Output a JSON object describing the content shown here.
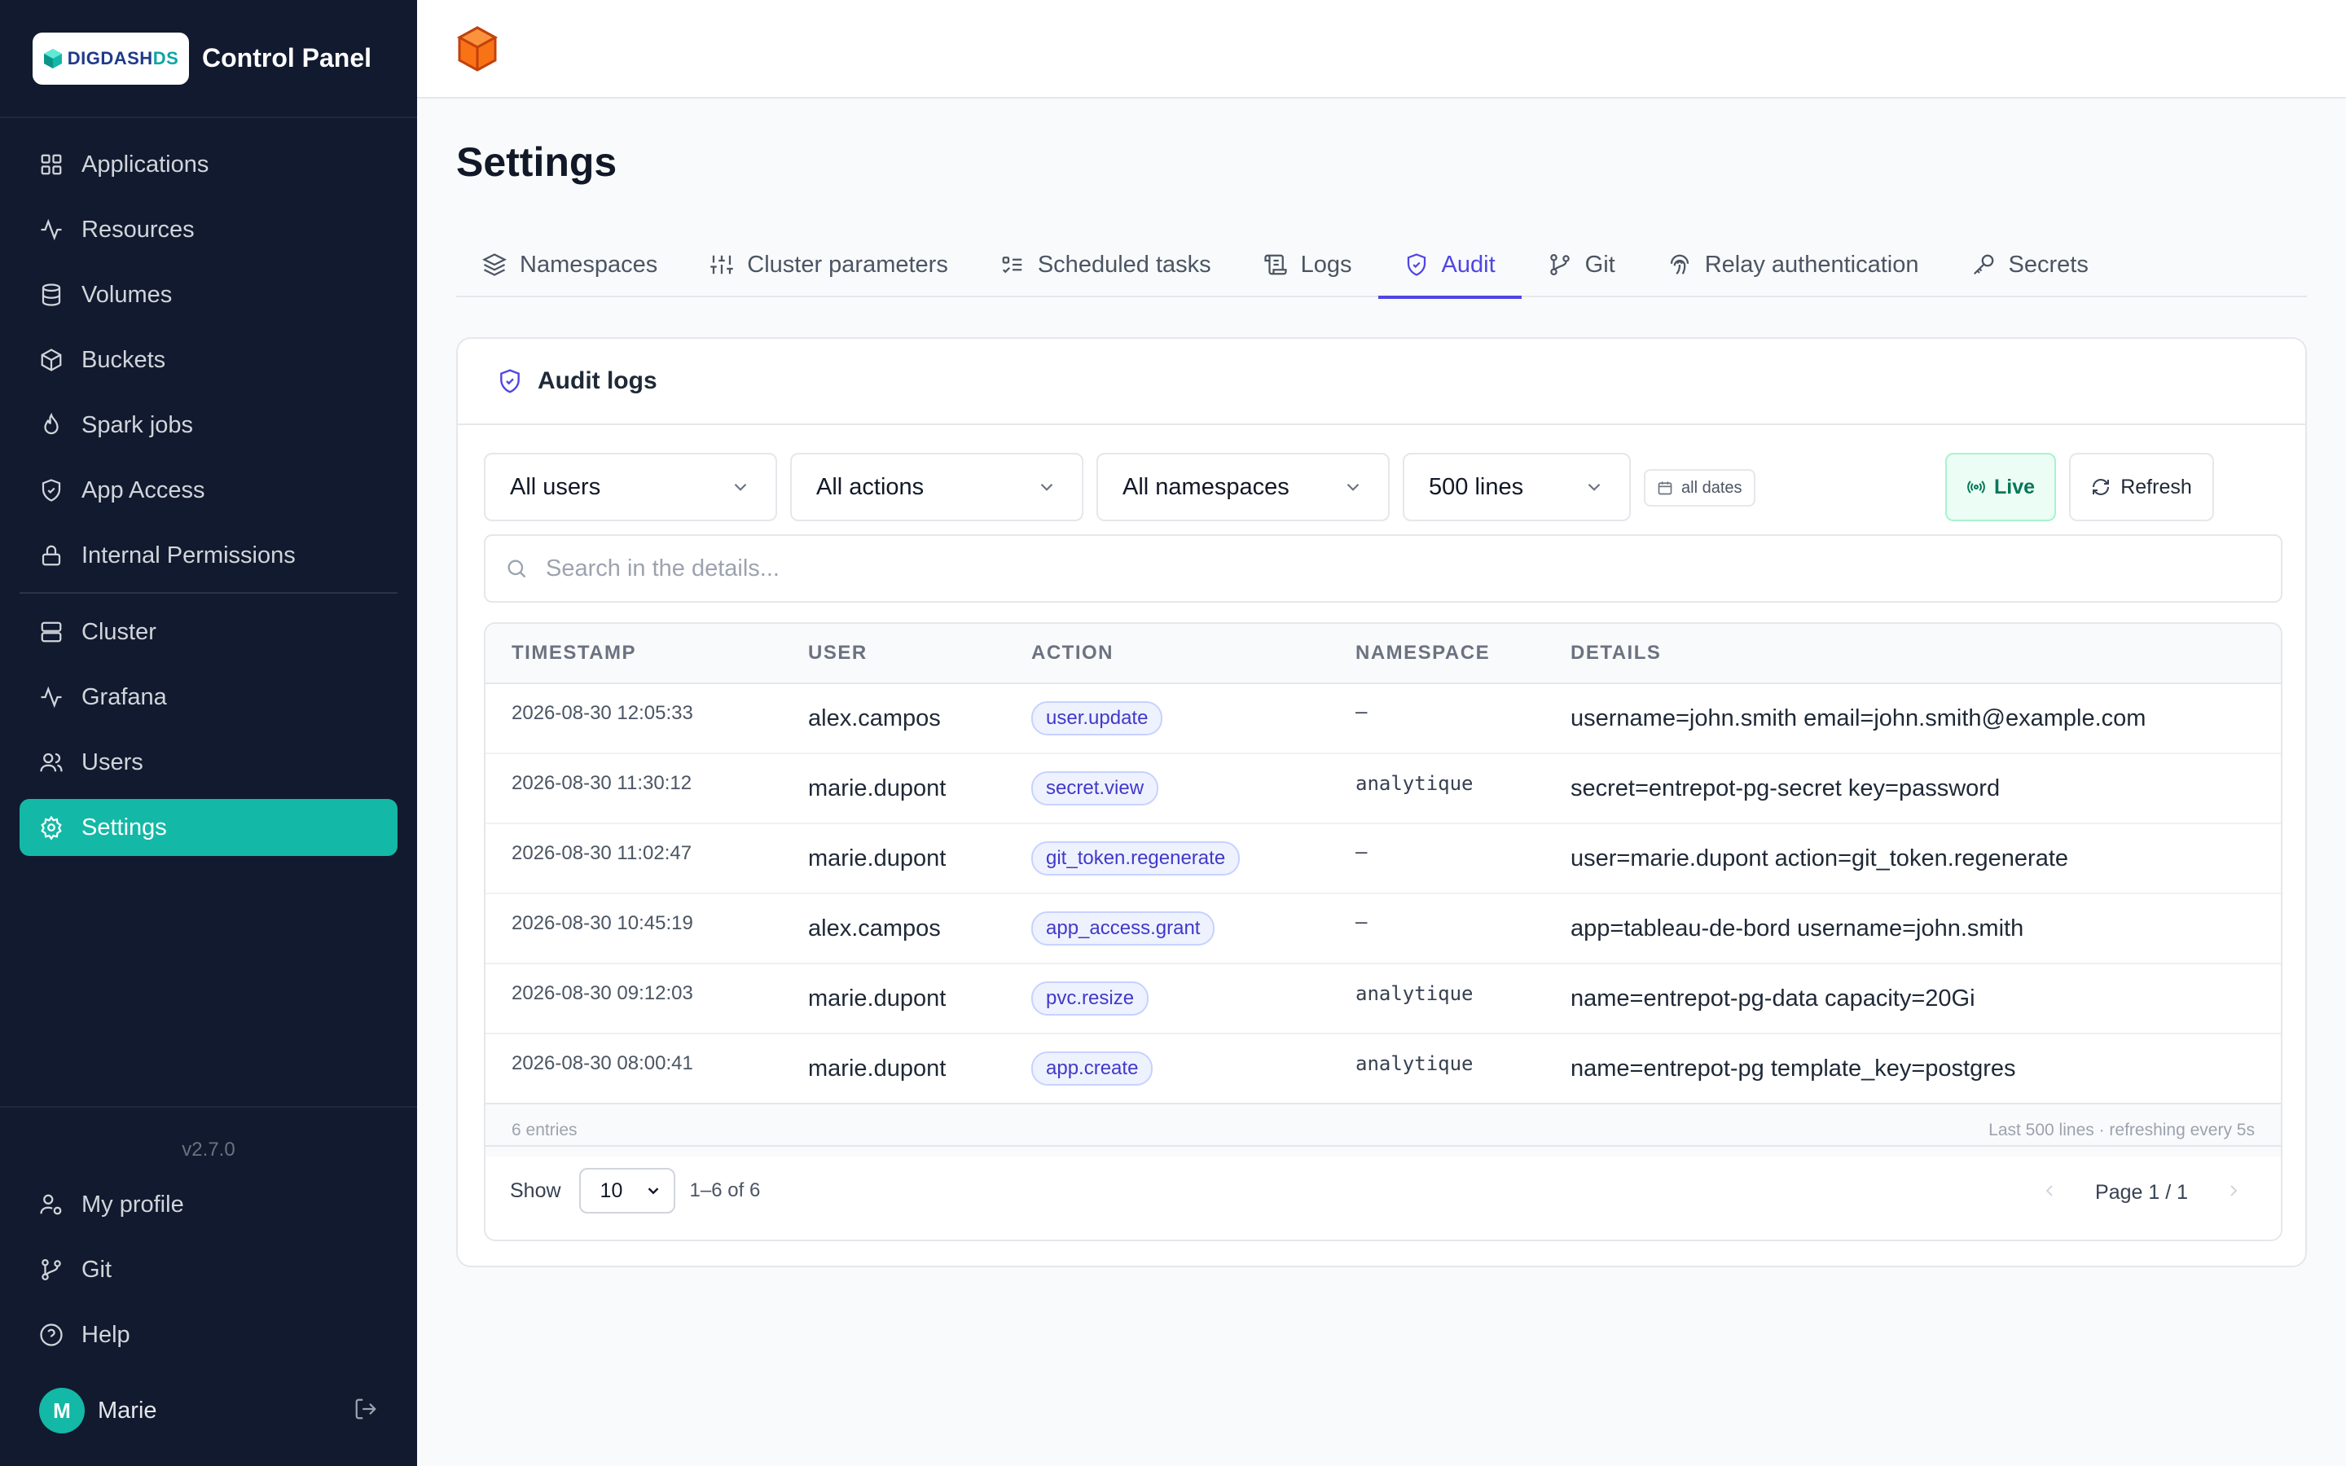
{
  "brand": {
    "logo_text": "DIGDASH",
    "logo_suffix": "DS",
    "title": "Control Panel"
  },
  "sidebar": {
    "items": [
      {
        "label": "Applications",
        "icon": "grid-icon"
      },
      {
        "label": "Resources",
        "icon": "activity-icon"
      },
      {
        "label": "Volumes",
        "icon": "database-icon"
      },
      {
        "label": "Buckets",
        "icon": "box-icon"
      },
      {
        "label": "Spark jobs",
        "icon": "flame-icon"
      },
      {
        "label": "App Access",
        "icon": "shield-icon"
      },
      {
        "label": "Internal Permissions",
        "icon": "lock-icon"
      }
    ],
    "items2": [
      {
        "label": "Cluster",
        "icon": "server-icon"
      },
      {
        "label": "Grafana",
        "icon": "activity-icon"
      },
      {
        "label": "Users",
        "icon": "users-icon"
      },
      {
        "label": "Settings",
        "icon": "gear-icon",
        "active": true
      }
    ],
    "version": "v2.7.0",
    "bottom_items": [
      {
        "label": "My profile",
        "icon": "user-cog-icon"
      },
      {
        "label": "Git",
        "icon": "git-branch-icon"
      },
      {
        "label": "Help",
        "icon": "help-circle-icon"
      }
    ],
    "profile": {
      "initial": "M",
      "name": "Marie"
    }
  },
  "page": {
    "title": "Settings"
  },
  "tabs": [
    {
      "label": "Namespaces",
      "icon": "layers-icon"
    },
    {
      "label": "Cluster parameters",
      "icon": "sliders-icon"
    },
    {
      "label": "Scheduled tasks",
      "icon": "list-todo-icon"
    },
    {
      "label": "Logs",
      "icon": "scroll-icon"
    },
    {
      "label": "Audit",
      "icon": "shield-check-icon",
      "active": true
    },
    {
      "label": "Git",
      "icon": "git-branch-icon"
    },
    {
      "label": "Relay authentication",
      "icon": "fingerprint-icon"
    },
    {
      "label": "Secrets",
      "icon": "key-icon"
    }
  ],
  "audit": {
    "title": "Audit logs",
    "filters": {
      "users": "All users",
      "actions": "All actions",
      "namespaces": "All namespaces",
      "lines": "500 lines",
      "dates": "all dates",
      "live": "Live",
      "refresh": "Refresh"
    },
    "search_placeholder": "Search in the details...",
    "columns": [
      "TIMESTAMP",
      "USER",
      "ACTION",
      "NAMESPACE",
      "DETAILS"
    ],
    "rows": [
      {
        "timestamp": "2026-08-30 12:05:33",
        "user": "alex.campos",
        "action": "user.update",
        "namespace": "—",
        "details": "username=john.smith email=john.smith@example.com"
      },
      {
        "timestamp": "2026-08-30 11:30:12",
        "user": "marie.dupont",
        "action": "secret.view",
        "namespace": "analytique",
        "details": "secret=entrepot-pg-secret key=password"
      },
      {
        "timestamp": "2026-08-30 11:02:47",
        "user": "marie.dupont",
        "action": "git_token.regenerate",
        "namespace": "—",
        "details": "user=marie.dupont action=git_token.regenerate"
      },
      {
        "timestamp": "2026-08-30 10:45:19",
        "user": "alex.campos",
        "action": "app_access.grant",
        "namespace": "—",
        "details": "app=tableau-de-bord username=john.smith"
      },
      {
        "timestamp": "2026-08-30 09:12:03",
        "user": "marie.dupont",
        "action": "pvc.resize",
        "namespace": "analytique",
        "details": "name=entrepot-pg-data capacity=20Gi"
      },
      {
        "timestamp": "2026-08-30 08:00:41",
        "user": "marie.dupont",
        "action": "app.create",
        "namespace": "analytique",
        "details": "name=entrepot-pg template_key=postgres"
      }
    ],
    "footer": {
      "entries": "6 entries",
      "status": "Last 500 lines · refreshing every 5s"
    },
    "pagination": {
      "show_label": "Show",
      "page_size": "10",
      "range": "1–6 of 6",
      "page": "Page 1 / 1"
    }
  },
  "colors": {
    "accent": "#14b8a6",
    "tab_active": "#4f46e5",
    "sidebar_bg": "#111a2e",
    "live_green": "#047857"
  }
}
